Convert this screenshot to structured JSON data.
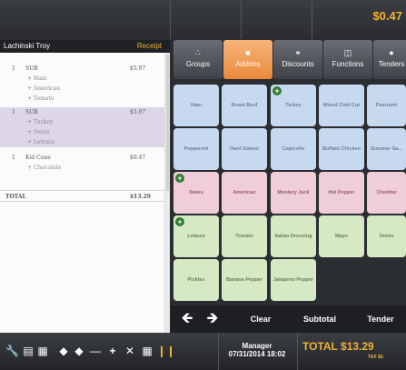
{
  "header": {
    "amount": "$0.47"
  },
  "receipt": {
    "customer": "Lachinski Troy",
    "label": "Receipt",
    "lines": [
      {
        "qty": "1",
        "name": "SUB",
        "price": "$5.97",
        "kind": "item"
      },
      {
        "mod": "+ Ham",
        "kind": "mod"
      },
      {
        "mod": "+ American",
        "kind": "mod"
      },
      {
        "mod": "+ Tomato",
        "kind": "mod"
      },
      {
        "qty": "1",
        "name": "SUB",
        "price": "$5.97",
        "kind": "item"
      },
      {
        "mod": "+ Turkey",
        "kind": "mod"
      },
      {
        "mod": "+ Swiss",
        "kind": "mod"
      },
      {
        "mod": "+ Lettuce",
        "kind": "mod"
      },
      {
        "qty": "1",
        "name": "Kid Cone",
        "price": "$0.47",
        "kind": "item"
      },
      {
        "mod": "+ Chocolate",
        "kind": "mod"
      }
    ],
    "total_label": "TOTAL",
    "total_value": "$13.29"
  },
  "tabs": [
    {
      "label": "Groups",
      "icon": "groups-icon"
    },
    {
      "label": "Addons",
      "icon": "addons-icon",
      "active": true
    },
    {
      "label": "Discounts",
      "icon": "discounts-icon"
    },
    {
      "label": "Functions",
      "icon": "functions-icon"
    },
    {
      "label": "Tenders",
      "icon": "tenders-icon"
    }
  ],
  "items": [
    [
      "Ham",
      "Roast Beef",
      "Turkey",
      "Mixed Cold Cut",
      "Pastrami"
    ],
    [
      "Pepperoni",
      "Hard Salami",
      "Capicollo",
      "Buffalo Chicken",
      "Summer Sa..."
    ],
    [
      "Swiss",
      "American",
      "Montery Jack",
      "Hot Pepper",
      "Cheddar"
    ],
    [
      "Lettuce",
      "Tomato",
      "Italian Dressing",
      "Mayo",
      "Onion"
    ],
    [
      "Pickles",
      "Banana Pepper",
      "Jalapeno Pepper"
    ]
  ],
  "actions": {
    "clear": "Clear",
    "subtotal": "Subtotal",
    "tender": "Tender"
  },
  "footer": {
    "user": "Manager",
    "datetime": "07/31/2014 18:02",
    "total_label": "TOTAL",
    "total_value": "$13.29",
    "tax": "TAX $0."
  },
  "colors": {
    "accent": "#f2b233",
    "active_tab": "#e98a3c",
    "meat_button": "#c6d9ee",
    "cheese_button": "#efcdd9",
    "veg_button": "#d5e9c4",
    "plus_badge": "#2f7a32"
  }
}
